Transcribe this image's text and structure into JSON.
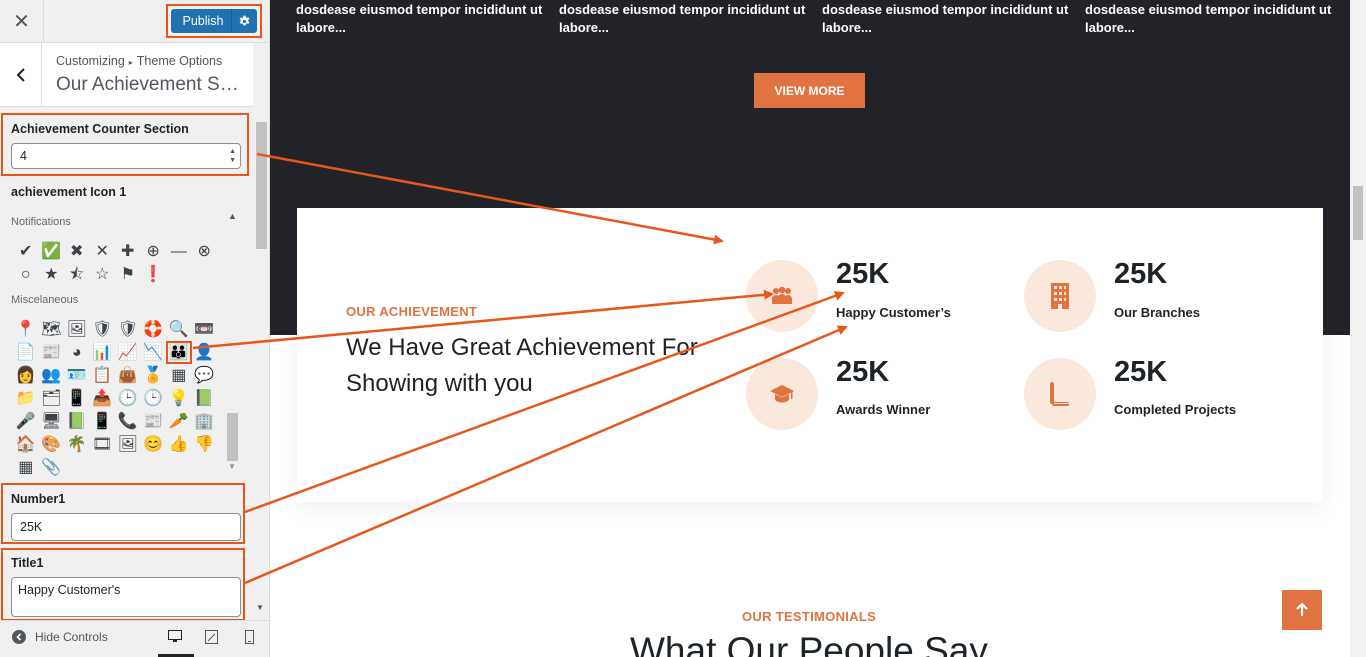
{
  "topbar": {
    "close_icon": "close-icon",
    "publish_label": "Publish",
    "settings_icon": "gear-icon"
  },
  "section": {
    "breadcrumb_root": "Customizing",
    "breadcrumb_parent": "Theme Options",
    "title": "Our Achievement Setti..."
  },
  "fields": {
    "counter_label": "Achievement Counter Section",
    "counter_value": "4",
    "icon_label": "achievement Icon 1",
    "notifications_label": "Notifications",
    "misc_label": "Miscelaneous",
    "number_label": "Number1",
    "number_value": "25K",
    "title_label": "Title1",
    "title_value": "Happy Customer's"
  },
  "icons_notifications": [
    "✔",
    "✅",
    "✖",
    "✕",
    "✚",
    "⊕",
    "—",
    "⊗",
    "○",
    "★",
    "⯪",
    "☆",
    "⚑",
    "❗"
  ],
  "icons_misc": [
    "📍",
    "🗺",
    "🖼",
    "🛡",
    "🛡",
    "🛟",
    "🔍",
    "📼",
    "📄",
    "📰",
    "◕",
    "📊",
    "📈",
    "📉",
    "👪",
    "👤",
    "👩",
    "👥",
    "🪪",
    "📋",
    "👜",
    "🏅",
    "▦",
    "💬",
    "📁",
    "🗂",
    "📱",
    "📤",
    "🕒",
    "🕒",
    "💡",
    "📗",
    "🎤",
    "🖥",
    "📗",
    "📱",
    "📞",
    "📰",
    "🥕",
    "🏢",
    "🏠",
    "🎨",
    "🌴",
    "🎞",
    "🖼",
    "😊",
    "👍",
    "👎",
    "▦",
    "📎"
  ],
  "footer": {
    "hide_controls": "Hide Controls",
    "desktop_icon": "desktop-icon",
    "tablet_icon": "tablet-icon",
    "mobile_icon": "mobile-icon"
  },
  "preview": {
    "card_texts": [
      "dosdease eiusmod tempor incididunt ut labore...",
      "dosdease eiusmod tempor incididunt ut labore...",
      "dosdease eiusmod tempor incididunt ut labore...",
      "dosdease eiusmod tempor incididunt ut labore..."
    ],
    "view_more": "VIEW MORE",
    "achievement_eyebrow": "OUR ACHIEVEMENT",
    "achievement_heading": "We Have Great Achievement For Showing with you",
    "stats": [
      {
        "number": "25K",
        "label": "Happy Customer’s",
        "icon": "people-icon"
      },
      {
        "number": "25K",
        "label": "Our Branches",
        "icon": "building-icon"
      },
      {
        "number": "25K",
        "label": "Awards Winner",
        "icon": "graduation-cap-icon"
      },
      {
        "number": "25K",
        "label": "Completed Projects",
        "icon": "book-icon"
      }
    ],
    "testimonials_eyebrow": "OUR TESTIMONIALS",
    "testimonials_heading": "What Our People Say",
    "accent_color": "#e0733f",
    "dark_bg": "#212328",
    "highlight_color": "#e8561a"
  }
}
